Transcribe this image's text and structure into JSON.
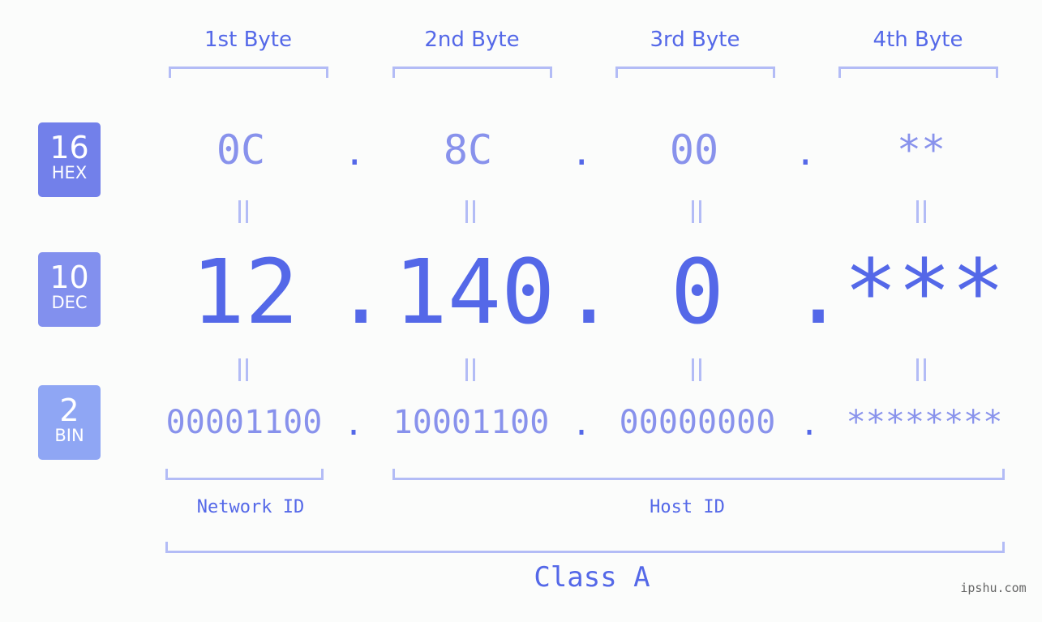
{
  "bytes": [
    "1st Byte",
    "2nd Byte",
    "3rd Byte",
    "4th Byte"
  ],
  "badges": {
    "hex": {
      "num": "16",
      "label": "HEX",
      "color": "#7280ea"
    },
    "dec": {
      "num": "10",
      "label": "DEC",
      "color": "#8290ee"
    },
    "bin": {
      "num": "2",
      "label": "BIN",
      "color": "#8fa6f4"
    }
  },
  "hex": [
    "0C",
    "8C",
    "00",
    "**"
  ],
  "dec": [
    "12",
    "140",
    "0",
    "***"
  ],
  "bin": [
    "00001100",
    "10001100",
    "00000000",
    "********"
  ],
  "separator": ".",
  "equals": "=",
  "network_id_label": "Network ID",
  "host_id_label": "Host ID",
  "class_label": "Class A",
  "watermark": "ipshu.com",
  "colors": {
    "accent": "#5468e8",
    "light": "#8892ec",
    "bracket": "#b3bcf6"
  }
}
